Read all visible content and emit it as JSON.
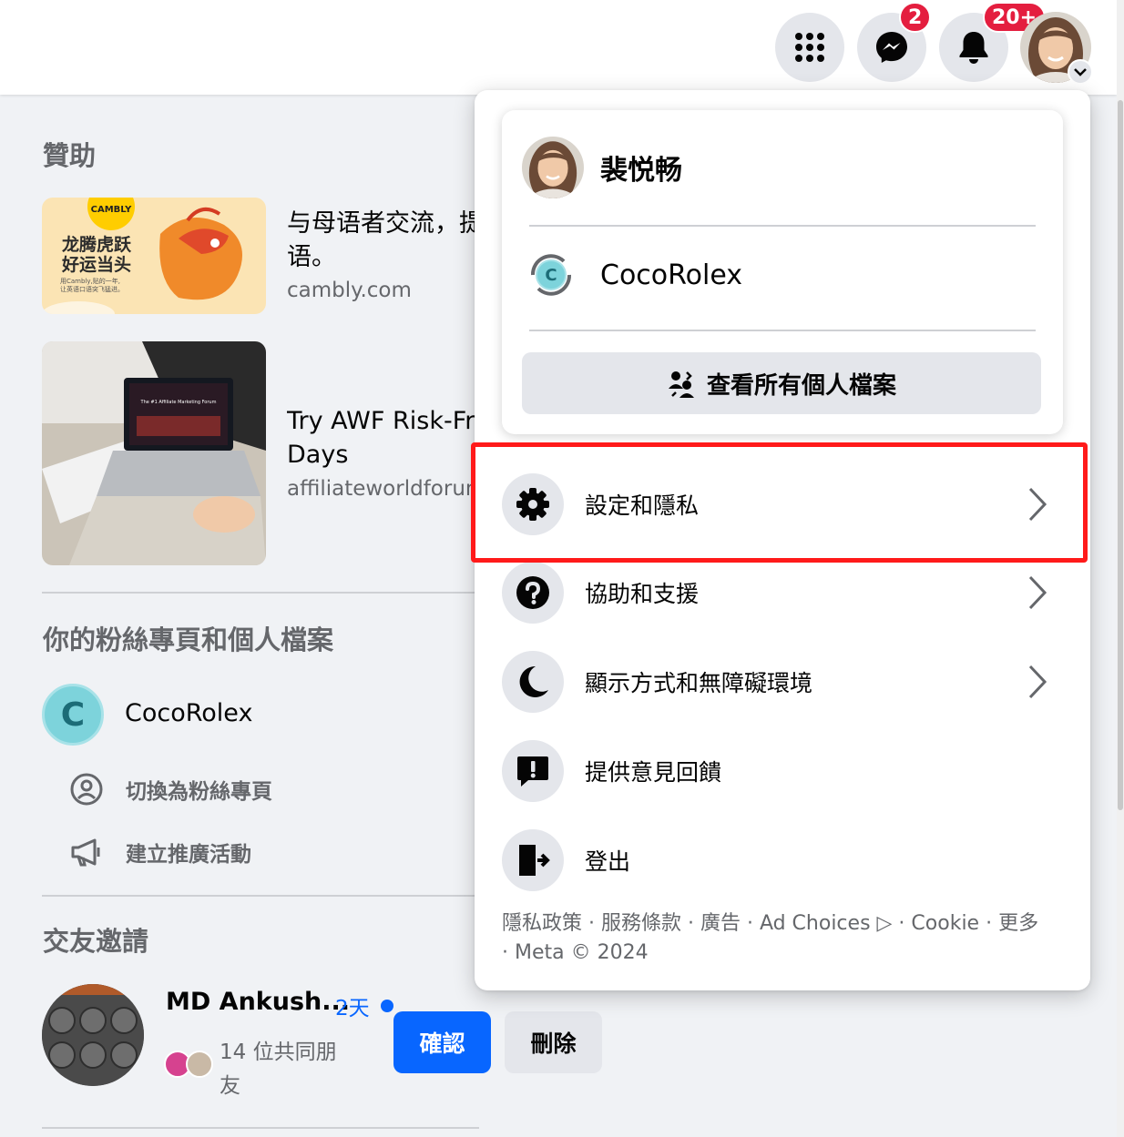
{
  "topbar": {
    "messenger_badge": "2",
    "notifications_badge": "20+"
  },
  "sponsored": {
    "title": "贊助",
    "ads": [
      {
        "image_brand": "CAMBLY",
        "image_headline_1": "龙腾虎跃",
        "image_headline_2": "好运当头",
        "image_caption_1": "用Cambly,贴的一年,",
        "image_caption_2": "让英语口语突飞猛进。",
        "text_line_1": "与母语者交流，提",
        "text_line_2": "语。",
        "domain": "cambly.com"
      },
      {
        "image_screen_text": "The #1 Affiliate Marketing Forum",
        "text_line_1": "Try AWF Risk-Fre",
        "text_line_2": "Days",
        "domain": "affiliateworldforum"
      }
    ]
  },
  "pages": {
    "title": "你的粉絲專頁和個人檔案",
    "page_initial": "C",
    "page_name": "CocoRolex",
    "switch_label": "切換為粉絲專頁",
    "promote_label": "建立推廣活動"
  },
  "friend_requests": {
    "title": "交友邀請",
    "name": "MD Ankush...",
    "time": "2天",
    "mutual": "14 位共同朋友",
    "confirm_label": "確認",
    "delete_label": "刪除"
  },
  "menu": {
    "user_name": "裴悦畅",
    "page_name": "CocoRolex",
    "page_initial": "C",
    "all_profiles_label": "查看所有個人檔案",
    "items": [
      {
        "label": "設定和隱私",
        "icon": "gear-icon",
        "has_chevron": true
      },
      {
        "label": "協助和支援",
        "icon": "question-icon",
        "has_chevron": true
      },
      {
        "label": "顯示方式和無障礙環境",
        "icon": "moon-icon",
        "has_chevron": true
      },
      {
        "label": "提供意見回饋",
        "icon": "feedback-icon",
        "has_chevron": false
      },
      {
        "label": "登出",
        "icon": "logout-icon",
        "has_chevron": false
      }
    ],
    "footer_line_1": "隱私政策 · 服務條款 · 廣告 · Ad Choices ▷ · Cookie · 更多",
    "footer_line_2": "· Meta © 2024"
  },
  "colors": {
    "accent_blue": "#0866ff",
    "badge_red": "#e41e3f",
    "highlight_red": "#ff1a1a"
  }
}
